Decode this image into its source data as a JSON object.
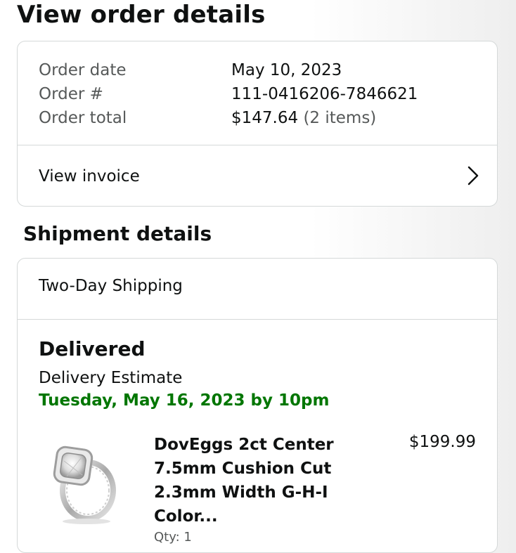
{
  "page_title": "View order details",
  "order": {
    "rows": [
      {
        "label": "Order date",
        "value": "May 10, 2023"
      },
      {
        "label": "Order #",
        "value": "111-0416206-7846621"
      },
      {
        "label": "Order total",
        "value": "$147.64",
        "extra": "(2 items)"
      }
    ],
    "invoice_label": "View invoice"
  },
  "shipment": {
    "section_title": "Shipment details",
    "method": "Two-Day Shipping",
    "status": "Delivered",
    "estimate_label": "Delivery Estimate",
    "estimate_date": "Tuesday, May 16, 2023 by 10pm",
    "product": {
      "title": "DovEggs 2ct Center 7.5mm Cushion Cut 2.3mm Width G-H-I Color...",
      "price": "$199.99",
      "qty": "Qty: 1"
    }
  },
  "colors": {
    "delivery_green": "#007600",
    "border": "#d5d9d9",
    "muted_text": "#565959"
  },
  "icons": [
    "chevron-right-icon",
    "ring-product-image"
  ]
}
